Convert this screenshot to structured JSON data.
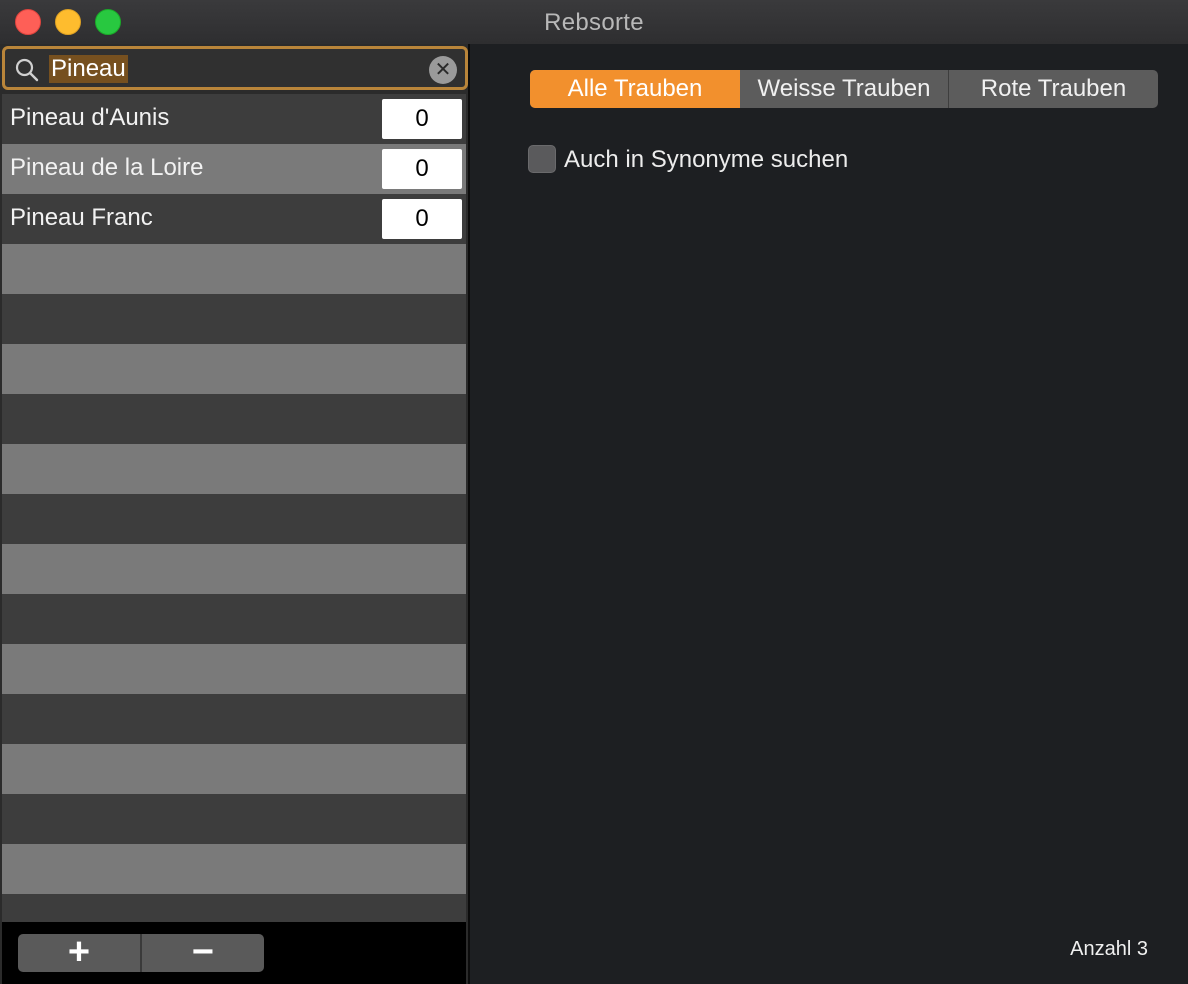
{
  "window": {
    "title": "Rebsorte"
  },
  "search": {
    "value": "Pineau",
    "icon": "magnifier",
    "clear_icon": "x-circle"
  },
  "list": {
    "items": [
      {
        "name": "Pineau d'Aunis",
        "count": "0"
      },
      {
        "name": "Pineau de la Loire",
        "count": "0"
      },
      {
        "name": "Pineau Franc",
        "count": "0"
      }
    ],
    "empty_rows": 14
  },
  "toolbar": {
    "add_label": "+",
    "remove_label": "−"
  },
  "filters": {
    "options": [
      "Alle Trauben",
      "Weisse Trauben",
      "Rote Trauben"
    ],
    "selected": "Alle Trauben"
  },
  "synonyms": {
    "label": "Auch in Synonyme suchen",
    "checked": false
  },
  "status": {
    "count_text": "Anzahl 3"
  },
  "colors": {
    "accent": "#f2902d",
    "search_focus": "#b9853a",
    "row_dark": "#3d3d3d",
    "row_light": "#7a7a7a",
    "panel_bg": "#1d1f22"
  }
}
